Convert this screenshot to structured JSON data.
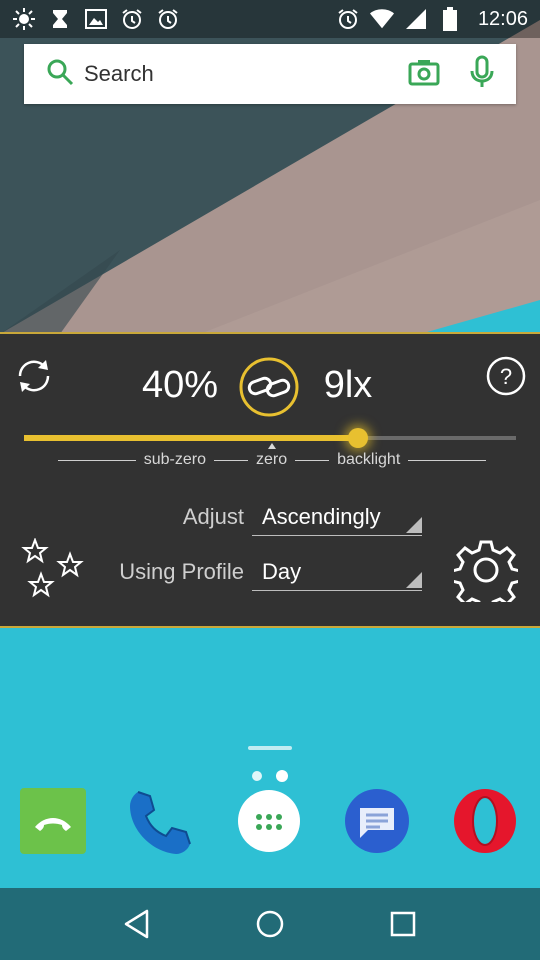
{
  "status_bar": {
    "time": "12:06",
    "left_icons": [
      "brightness-icon",
      "hourglass-icon",
      "image-icon",
      "alarm-icon",
      "alarm-icon"
    ],
    "right_icons": [
      "alarm-icon",
      "wifi-icon",
      "signal-icon",
      "battery-icon"
    ]
  },
  "search": {
    "label": "Search",
    "accent_color": "#3aa757"
  },
  "widget": {
    "brightness_percent": "40%",
    "lux": "9lx",
    "slider_value": 0.678,
    "slider_color": "#e8c030",
    "scale_labels": [
      "sub-zero",
      "zero",
      "backlight"
    ],
    "adjust_label": "Adjust",
    "adjust_value": "Ascendingly",
    "profile_label": "Using Profile",
    "profile_value": "Day",
    "help_symbol": "?"
  },
  "home": {
    "dock_apps": [
      "phone-call-app",
      "dialer-app",
      "app-drawer",
      "messages-app",
      "opera-browser"
    ]
  },
  "nav": {
    "buttons": [
      "back",
      "home",
      "recents"
    ]
  }
}
